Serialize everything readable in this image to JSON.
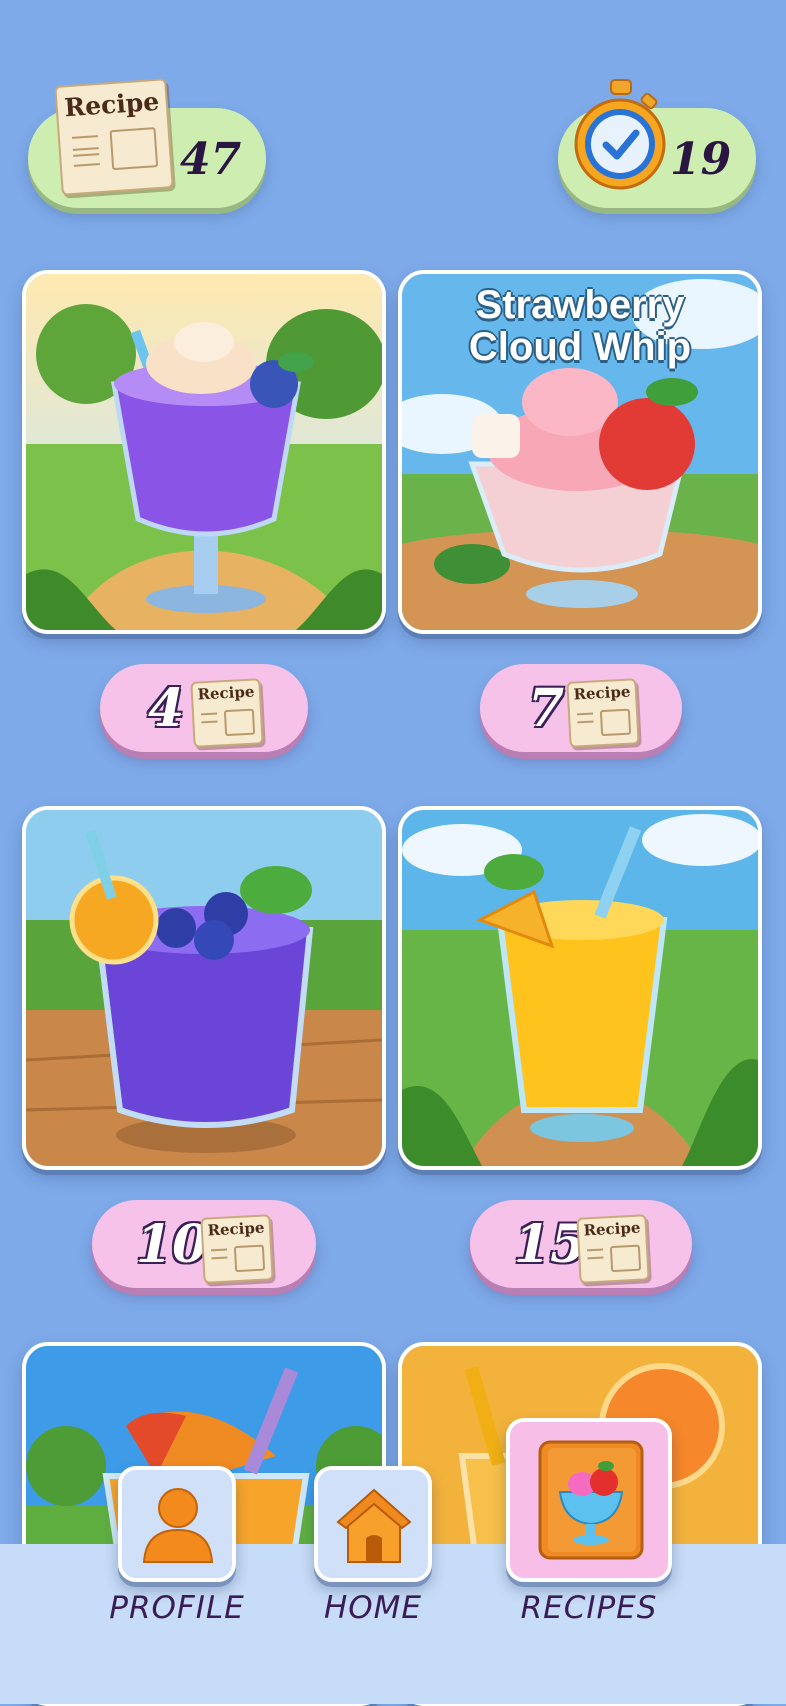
{
  "header": {
    "recipe_icon_text": "Recipe",
    "recipe_count": "47",
    "timer_value": "19"
  },
  "recipes": [
    {
      "title": "",
      "cost": "4",
      "recipe_icon_text": "Recipe"
    },
    {
      "title": "Strawberry Cloud Whip",
      "title_line1": "Strawberry",
      "title_line2": "Cloud Whip",
      "cost": "7",
      "recipe_icon_text": "Recipe"
    },
    {
      "title": "",
      "cost": "10",
      "recipe_icon_text": "Recipe"
    },
    {
      "title": "",
      "cost": "15",
      "recipe_icon_text": "Recipe"
    }
  ],
  "nav": {
    "profile": "PROFILE",
    "home": "HOME",
    "recipes": "RECIPES",
    "active": "recipes"
  },
  "colors": {
    "background": "#7eaaea",
    "header_pill": "#cdeeb0",
    "cost_pill": "#f6c2ea",
    "nav_bar": "#c6dcf8",
    "icon_orange": "#f08a1e"
  }
}
